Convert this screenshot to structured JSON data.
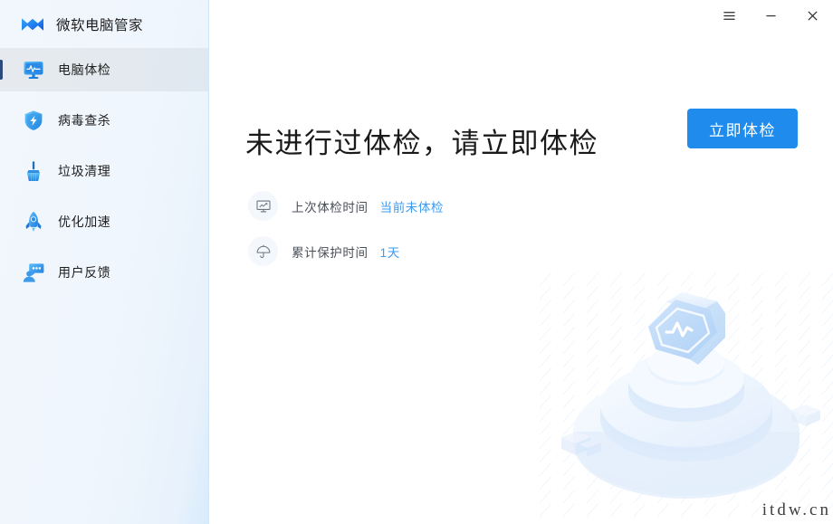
{
  "app": {
    "brand_title": "微软电脑管家",
    "logo_icon": "pcmanager-logo-icon"
  },
  "window_controls": {
    "menu_label": "☰",
    "menu_icon": "hamburger-menu-icon",
    "minimize_label": "−",
    "minimize_icon": "minimize-icon",
    "close_label": "✕",
    "close_icon": "close-icon"
  },
  "sidebar": {
    "items": [
      {
        "label": "电脑体检",
        "icon": "monitor-pulse-icon",
        "active": true
      },
      {
        "label": "病毒查杀",
        "icon": "shield-bolt-icon",
        "active": false
      },
      {
        "label": "垃圾清理",
        "icon": "broom-icon",
        "active": false
      },
      {
        "label": "优化加速",
        "icon": "rocket-icon",
        "active": false
      },
      {
        "label": "用户反馈",
        "icon": "feedback-chat-icon",
        "active": false
      }
    ]
  },
  "main": {
    "headline": "未进行过体检，请立即体检",
    "cta_label": "立即体检",
    "info": [
      {
        "icon": "monitor-chart-icon",
        "label": "上次体检时间",
        "value": "当前未体检"
      },
      {
        "icon": "umbrella-icon",
        "label": "累计保护时间",
        "value": "1天"
      }
    ],
    "illustration_icon": "hexagon-pulse-pedestal-illustration",
    "watermark": "itdw.cn"
  },
  "colors": {
    "accent_blue": "#1f8ced",
    "link_blue": "#3d9bf0",
    "sidebar_bg": "#f0f6fd",
    "active_indicator": "#2c4b7c",
    "text_primary": "#1a1a1a",
    "text_secondary": "#4a4f57"
  }
}
